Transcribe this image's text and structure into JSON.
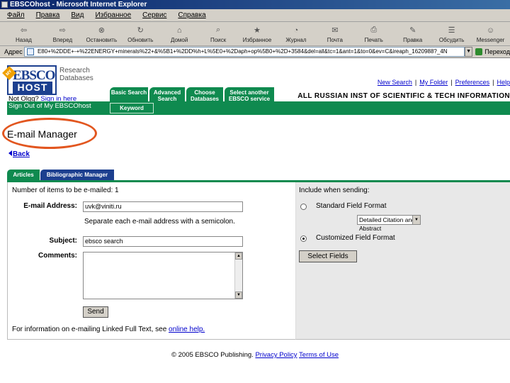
{
  "window": {
    "title": "EBSCOhost - Microsoft Internet Explorer"
  },
  "menu": [
    "Файл",
    "Правка",
    "Вид",
    "Избранное",
    "Сервис",
    "Справка"
  ],
  "toolbar": [
    {
      "label": "Назад",
      "icon": "back-arrow-icon"
    },
    {
      "label": "Вперед",
      "icon": "forward-arrow-icon"
    },
    {
      "label": "Остановить",
      "icon": "stop-icon"
    },
    {
      "label": "Обновить",
      "icon": "refresh-icon"
    },
    {
      "label": "Домой",
      "icon": "home-icon"
    },
    {
      "label": "Поиск",
      "icon": "search-icon"
    },
    {
      "label": "Избранное",
      "icon": "favorites-icon"
    },
    {
      "label": "Журнал",
      "icon": "history-icon"
    },
    {
      "label": "Почта",
      "icon": "mail-icon"
    },
    {
      "label": "Печать",
      "icon": "print-icon"
    },
    {
      "label": "Правка",
      "icon": "edit-icon"
    },
    {
      "label": "Обсудить",
      "icon": "discuss-icon"
    },
    {
      "label": "Messenger",
      "icon": "messenger-icon"
    }
  ],
  "address": {
    "label": "Адрес",
    "url": "E80+%2DDE+-+%22ENERGY+minerals%22+&%5B1+%2DD%h+L%5E0+%2Daph+op%5B0+%2D+3584&del=all&tc=1&ant=1&to=0&ev=C&ireaph_1620988?_4N",
    "go": "Переход"
  },
  "logo": {
    "top": "EBSCO",
    "bottom": "HOST",
    "ribbon": "MY",
    "tagline": "Research Databases"
  },
  "not_org": {
    "prefix": "Not Olgg?",
    "link": "Sign in here"
  },
  "search_tabs": [
    {
      "label": "Basic Search"
    },
    {
      "label": "Advanced Search"
    },
    {
      "label": "Choose Databases"
    },
    {
      "label": "Select another EBSCO service"
    }
  ],
  "top_links": [
    "New Search",
    "My Folder",
    "Preferences",
    "Help"
  ],
  "institution": "ALL RUSSIAN INST OF SCIENTIFIC & TECH INFORMATION",
  "signout": "Sign Out of My EBSCOhost",
  "keyword_tab": "Keyword",
  "heading": "E-mail Manager",
  "back": "Back",
  "mail_tabs": {
    "articles": "Articles",
    "biblio": "Bibliographic Manager"
  },
  "form": {
    "count_text": "Number of items to be e-mailed: 1",
    "email_label": "E-mail Address:",
    "email_value": "uvk@viniti.ru",
    "hint": "Separate each e-mail address with a semicolon.",
    "subject_label": "Subject:",
    "subject_value": "ebsco search",
    "comments_label": "Comments:",
    "send": "Send",
    "footer_text": "For information on e-mailing Linked Full Text, see",
    "footer_link": "online help."
  },
  "options": {
    "title": "Include when sending:",
    "standard": "Standard Field Format",
    "standard_select": "Detailed Citation and Abstract",
    "custom": "Customized Field Format",
    "select_fields": "Select Fields"
  },
  "footer": {
    "copyright": "© 2005 EBSCO Publishing.",
    "privacy": "Privacy Policy",
    "terms": "Terms of Use"
  },
  "colors": {
    "green": "#0f8a4f",
    "navy": "#1c3f8f",
    "highlight_oval": "#e2561f"
  }
}
